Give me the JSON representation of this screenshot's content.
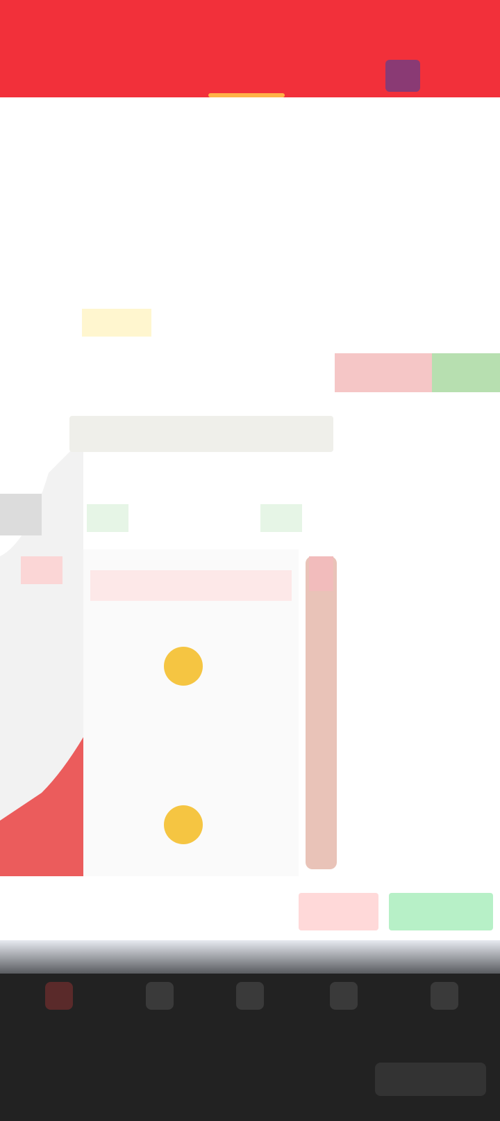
{
  "header": {
    "left_title": "",
    "right_title": "",
    "tabs": [
      {
        "label": ""
      },
      {
        "label": ""
      },
      {
        "label": ""
      },
      {
        "label": ""
      },
      {
        "label": ""
      }
    ],
    "active_tab_index": 2,
    "colors": {
      "brand": "#f2303a",
      "tab_indicator": "#ffb347"
    }
  },
  "quote": {
    "last_price": "",
    "change": "",
    "stats": [
      {
        "label": "",
        "value": ""
      },
      {
        "label": "",
        "value": ""
      },
      {
        "label": "",
        "value": ""
      },
      {
        "label": "",
        "value": ""
      }
    ],
    "sub_strip": ""
  },
  "periods": {
    "tabs": [
      "",
      "",
      "",
      "",
      "",
      "",
      ""
    ],
    "selected_index": 1,
    "indicators": [
      "",
      "",
      "",
      "",
      ""
    ]
  },
  "chart": {
    "ma_legend": "",
    "price_tags": [
      "",
      ""
    ],
    "colors": {
      "up": "#e83b3b",
      "down": "#2ca94a"
    }
  },
  "trade_card": {
    "title": "",
    "rows": [
      {
        "label": "",
        "value": ""
      },
      {
        "label": "",
        "value": ""
      },
      {
        "label": "",
        "value": ""
      }
    ]
  },
  "order_book": {
    "header": "",
    "rows": [
      {
        "label": "",
        "price": "",
        "vol": ""
      },
      {
        "label": "",
        "price": "",
        "vol": ""
      },
      {
        "label": "",
        "price": "",
        "vol": ""
      },
      {
        "label": "",
        "price": "",
        "vol": ""
      },
      {
        "label": "",
        "price": "",
        "vol": ""
      },
      {
        "label": "",
        "price": "",
        "vol": ""
      },
      {
        "label": "",
        "price": "",
        "vol": ""
      },
      {
        "label": "",
        "price": "",
        "vol": ""
      },
      {
        "label": "",
        "price": "",
        "vol": ""
      },
      {
        "label": "",
        "price": "",
        "vol": ""
      },
      {
        "label": "",
        "price": "",
        "vol": ""
      },
      {
        "label": "",
        "price": "",
        "vol": ""
      }
    ]
  },
  "actions": {
    "items": [
      {
        "label": ""
      },
      {
        "label": ""
      },
      {
        "label": ""
      }
    ],
    "sell_label": "",
    "buy_label": ""
  },
  "bottom_nav": {
    "items": [
      {
        "label": "",
        "icon": "home-icon"
      },
      {
        "label": "",
        "icon": "market-icon"
      },
      {
        "label": "",
        "icon": "trade-icon"
      },
      {
        "label": "",
        "icon": "news-icon"
      },
      {
        "label": "",
        "icon": "profile-icon"
      }
    ],
    "active_index": 0,
    "system_button": ""
  }
}
